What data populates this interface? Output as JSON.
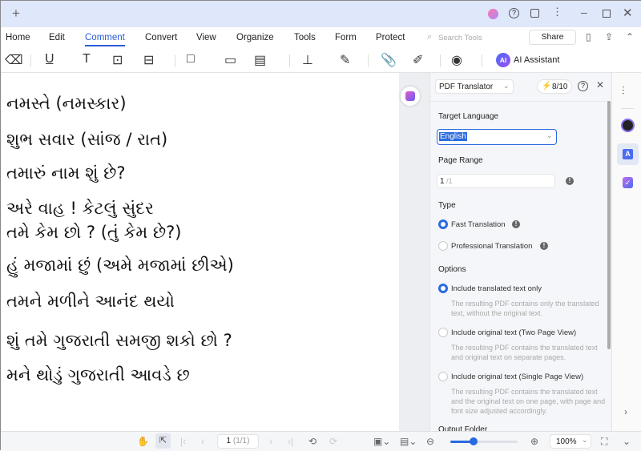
{
  "titlebar": {
    "new_tab": "+",
    "buttons": [
      "avatar",
      "help",
      "feedback",
      "more",
      "minimize",
      "maximize",
      "close"
    ]
  },
  "menu": {
    "items": [
      "Home",
      "Edit",
      "Comment",
      "Convert",
      "View",
      "Organize",
      "Tools",
      "Form",
      "Protect"
    ],
    "active": "Comment",
    "search_placeholder": "Search Tools",
    "share": "Share"
  },
  "toolbar": {
    "ai_assistant": "AI Assistant",
    "ai_badge": "AI"
  },
  "document": {
    "lines": [
      "નમસ્તે (નમસ્કાર)",
      "શુભ સવાર (સાંજ / રાત)",
      "તમારું નામ શું છે?",
      "અરે વાહ ! કેટલું સુંદર",
      "તમે કેમ છો ? (તું કેમ છે?)",
      "હું મજામાં છું (અમે મજામાં છીએ)",
      "તમને મળીને આનંદ થયો",
      "શું તમે ગુજરાતી સમજી શકો છો ?",
      "મને થોડું ગુજરાતી આવડે છ"
    ]
  },
  "panel": {
    "tool_select": "PDF Translator",
    "credits": "8/10",
    "target_language_label": "Target Language",
    "target_language": "English",
    "page_range_label": "Page Range",
    "page_range_value": "1",
    "page_range_total": "/1",
    "type_label": "Type",
    "types": [
      {
        "label": "Fast Translation",
        "selected": true
      },
      {
        "label": "Professional Translation",
        "selected": false
      }
    ],
    "options_label": "Options",
    "options": [
      {
        "label": "Include translated text only",
        "desc": "The resulting PDF contains only the translated text, without the original text.",
        "selected": true
      },
      {
        "label": "Include original text (Two Page View)",
        "desc": "The resulting PDF contains the translated text and original text on separate pages.",
        "selected": false
      },
      {
        "label": "Include original text (Single Page View)",
        "desc": "The resulting PDF contains the translated text and the original text on one page, with page and font size adjusted accordingly.",
        "selected": false
      }
    ],
    "output_folder_label": "Output Folder"
  },
  "bottombar": {
    "page": "1",
    "page_total": "(1/1)",
    "zoom": "100%",
    "zoom_slider_percent": 35
  },
  "colors": {
    "accent": "#2a5bd7",
    "titlebar": "#dfe7fb"
  }
}
